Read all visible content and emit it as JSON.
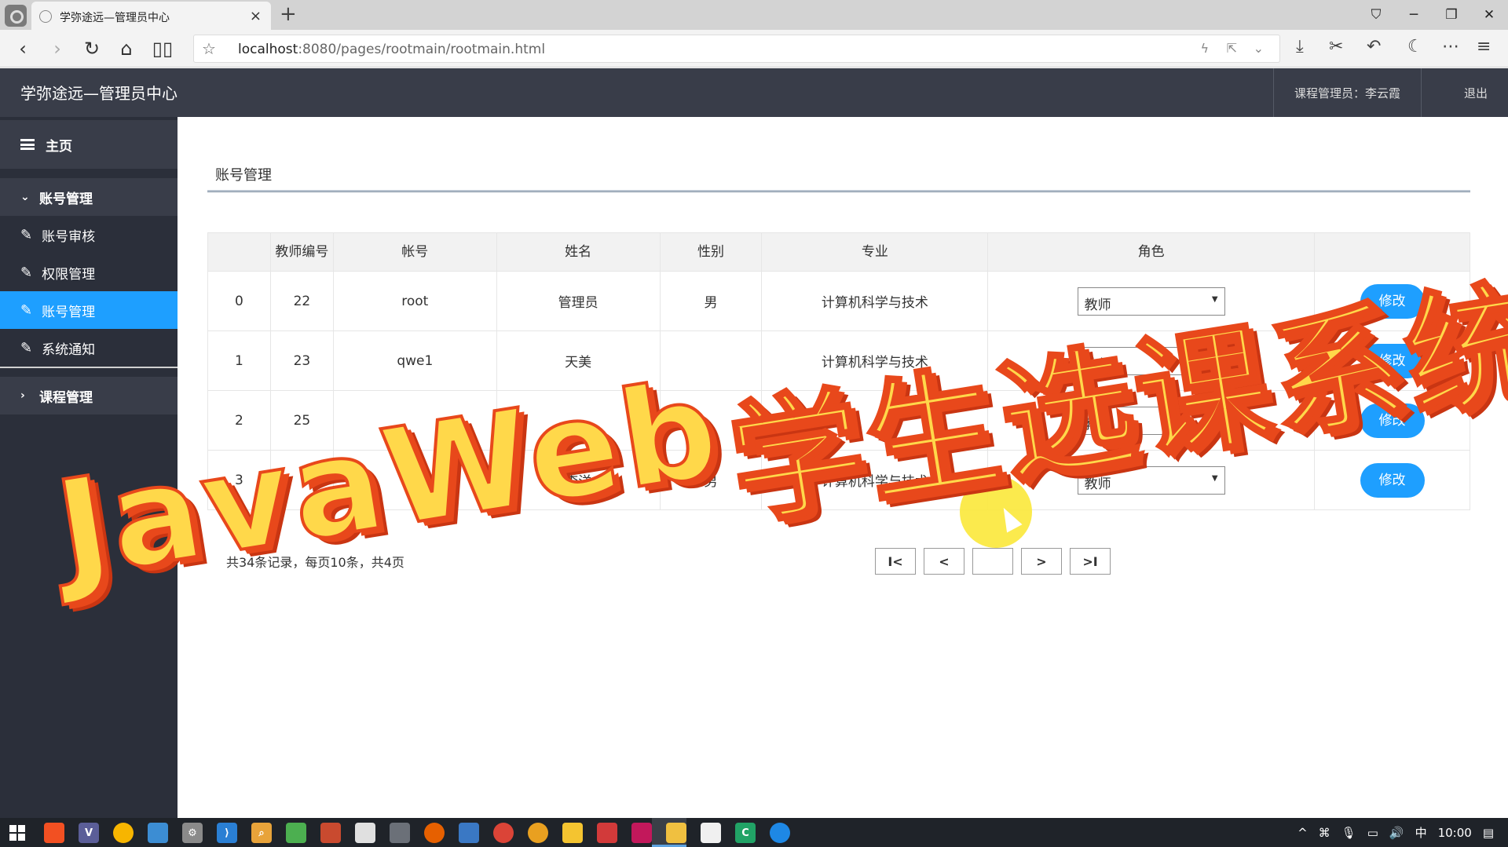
{
  "browser": {
    "tab_title": "学弥途远—管理员中心",
    "tab_close": "×",
    "new_tab": "+",
    "url_host": "localhost",
    "url_rest": ":8080/pages/rootmain/rootmain.html"
  },
  "header": {
    "brand": "学弥途远—管理员中心",
    "admin_label": "课程管理员：李云霞",
    "logout": "退出"
  },
  "sidebar": {
    "home": "主页",
    "group_account": "账号管理",
    "items": [
      {
        "label": "账号审核",
        "active": false
      },
      {
        "label": "权限管理",
        "active": false
      },
      {
        "label": "账号管理",
        "active": true
      },
      {
        "label": "系统通知",
        "active": false
      }
    ],
    "group_course": "课程管理"
  },
  "main": {
    "breadcrumb": "账号管理",
    "columns": [
      "",
      "教师编号",
      "帐号",
      "姓名",
      "性别",
      "专业",
      "角色",
      ""
    ],
    "rows": [
      {
        "idx": "0",
        "id": "22",
        "account": "root",
        "name": "管理员",
        "gender": "男",
        "major": "计算机科学与技术",
        "role": "教师",
        "action": "修改"
      },
      {
        "idx": "1",
        "id": "23",
        "account": "qwe1",
        "name": "天美",
        "gender": "",
        "major": "计算机科学与技术",
        "role": "教师",
        "action": "修改"
      },
      {
        "idx": "2",
        "id": "25",
        "account": "",
        "name": "",
        "gender": "",
        "major": "",
        "role": "教师",
        "action": "修改"
      },
      {
        "idx": "3",
        "id": "",
        "account": "ly",
        "name": "李洋",
        "gender": "男",
        "major": "计算机科学与技术",
        "role": "教师",
        "action": "修改"
      }
    ],
    "records": "共34条记录，每页10条，共4页",
    "pager": {
      "first": "I<",
      "prev": "<",
      "current": "",
      "next": ">",
      "last": ">I"
    }
  },
  "overlay": {
    "line1": "JavaWeb",
    "line2": "学生选课系统"
  },
  "taskbar": {
    "clock": "10:00",
    "ime": "中"
  },
  "colors": {
    "header_bg": "#393d49",
    "sidebar_bg": "#2b2f3a",
    "accent": "#1e9fff",
    "overlay_fill": "#ffd84a",
    "overlay_stroke": "#e8481b"
  }
}
